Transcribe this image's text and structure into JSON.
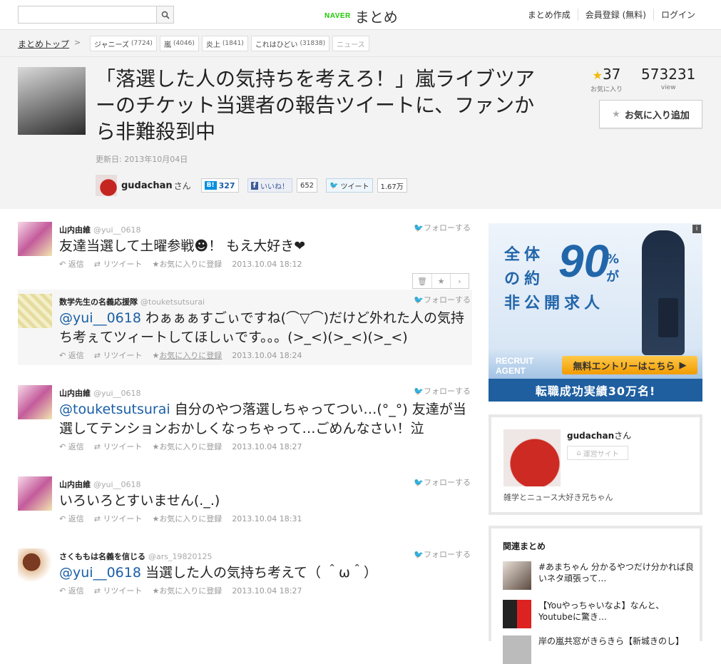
{
  "topbar": {
    "search_placeholder": "",
    "logo_naver": "NAVER",
    "logo_matome": "まとめ",
    "links": [
      "まとめ作成",
      "会員登録 (無料)",
      "ログイン"
    ]
  },
  "breadcrumb": {
    "top": "まとめトップ",
    "sep": ">",
    "tags": [
      {
        "label": "ジャニーズ",
        "count": "(7724)"
      },
      {
        "label": "嵐",
        "count": "(4046)"
      },
      {
        "label": "炎上",
        "count": "(1841)"
      },
      {
        "label": "これはひどい",
        "count": "(31838)"
      },
      {
        "label": "ニュース",
        "count": ""
      }
    ]
  },
  "article": {
    "title": "「落選した人の気持ちを考えろ！」嵐ライブツアーのチケット当選者の報告ツイートに、ファンから非難殺到中",
    "updated": "更新日: 2013年10月04日",
    "author": "gudachan",
    "author_suffix": "さん",
    "hatena_label": "B!",
    "hatena_count": "327",
    "fb_label": "いいね！",
    "fb_count": "652",
    "tweet_label": "ツイート",
    "tweet_count": "1.67万",
    "fav_count": "37",
    "fav_label": "お気に入り",
    "views": "573231",
    "views_label": "view",
    "fav_button": "お気に入り追加"
  },
  "tweets": [
    {
      "user": "山内由維",
      "handle": "@yui__0618",
      "mention": "",
      "text": "友達当選して土曜参戦☻！ もえ大好き❤",
      "time": "2013.10.04 18:12"
    },
    {
      "user": "数学先生の名義応援隊",
      "handle": "@touketsutsurai",
      "mention": "@yui__0618",
      "text": " わぁぁぁすごぃですね(⌒▽⌒)だけど外れた人の気持ち考ぇてツィートしてほしぃです。。。(>_<)(>_<)(>_<)",
      "time": "2013.10.04 18:24"
    },
    {
      "user": "山内由維",
      "handle": "@yui__0618",
      "mention": "@touketsutsurai",
      "text": " 自分のやつ落選しちゃってつい…(°_°) 友達が当選してテンションおかしくなっちゃって…ごめんなさい！泣",
      "time": "2013.10.04 18:27"
    },
    {
      "user": "山内由維",
      "handle": "@yui__0618",
      "mention": "",
      "text": "いろいろとすいません(._.)",
      "time": "2013.10.04 18:31"
    },
    {
      "user": "さくももは名義を信じる",
      "handle": "@ars_19820125",
      "mention": "@yui__0618",
      "text": " 当選した人の気持ち考えて（ ＾ω＾）",
      "time": "2013.10.04 18:27"
    }
  ],
  "tweet_ui": {
    "follow": "フォローする",
    "reply": "返信",
    "retweet": "リツイート",
    "favorite": "お気に入りに登録"
  },
  "ad": {
    "line1": "全体",
    "line2": "の約",
    "big": "90",
    "pct": "%",
    "ga": "が",
    "line3": "非公開求人",
    "logo1": "RECRUIT",
    "logo2": "AGENT",
    "cta": "無料エントリーはこちら",
    "foot": "転職成功実績30万名!",
    "info": "i"
  },
  "profile": {
    "name": "gudachan",
    "suffix": "さん",
    "site": "運営サイト",
    "desc": "雑学とニュース大好き兄ちゃん"
  },
  "related": {
    "heading": "関連まとめ",
    "items": [
      "#あまちゃん 分かるやつだけ分かれば良いネタ頑張って…",
      "【Youやっちゃいなよ】なんと、Youtubeに驚き…",
      "岸の嵐共窓がきらきら【新城きのし】"
    ]
  },
  "colors": {
    "accent": "#1a5ea7",
    "naver_green": "#1ec800",
    "star": "#f5b800",
    "ad_blue": "#2266aa"
  },
  "icons": [
    "search-icon",
    "star-icon",
    "twitter-icon",
    "reply-icon",
    "retweet-icon",
    "trash-icon",
    "chevron-right-icon",
    "home-icon"
  ]
}
